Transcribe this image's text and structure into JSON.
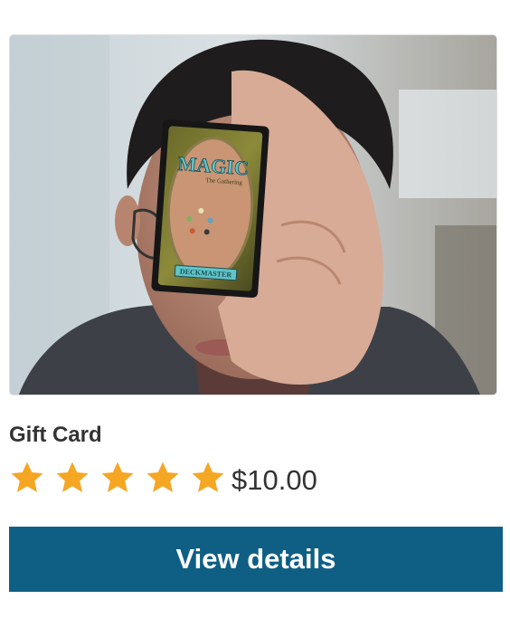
{
  "product": {
    "image_alt": "Person holding a Magic: The Gathering card",
    "card_logo": "MAGIC",
    "card_subtitle": "The Gathering",
    "card_banner": "DECKMASTER",
    "title": "Gift Card",
    "rating": 5,
    "rating_max": 5,
    "price": "$10.00",
    "button_label": "View details"
  },
  "colors": {
    "star": "#f5a623",
    "button_background": "#0f5f85",
    "button_text": "#ffffff",
    "text": "#333333"
  },
  "icons": {
    "star": "star-icon"
  }
}
